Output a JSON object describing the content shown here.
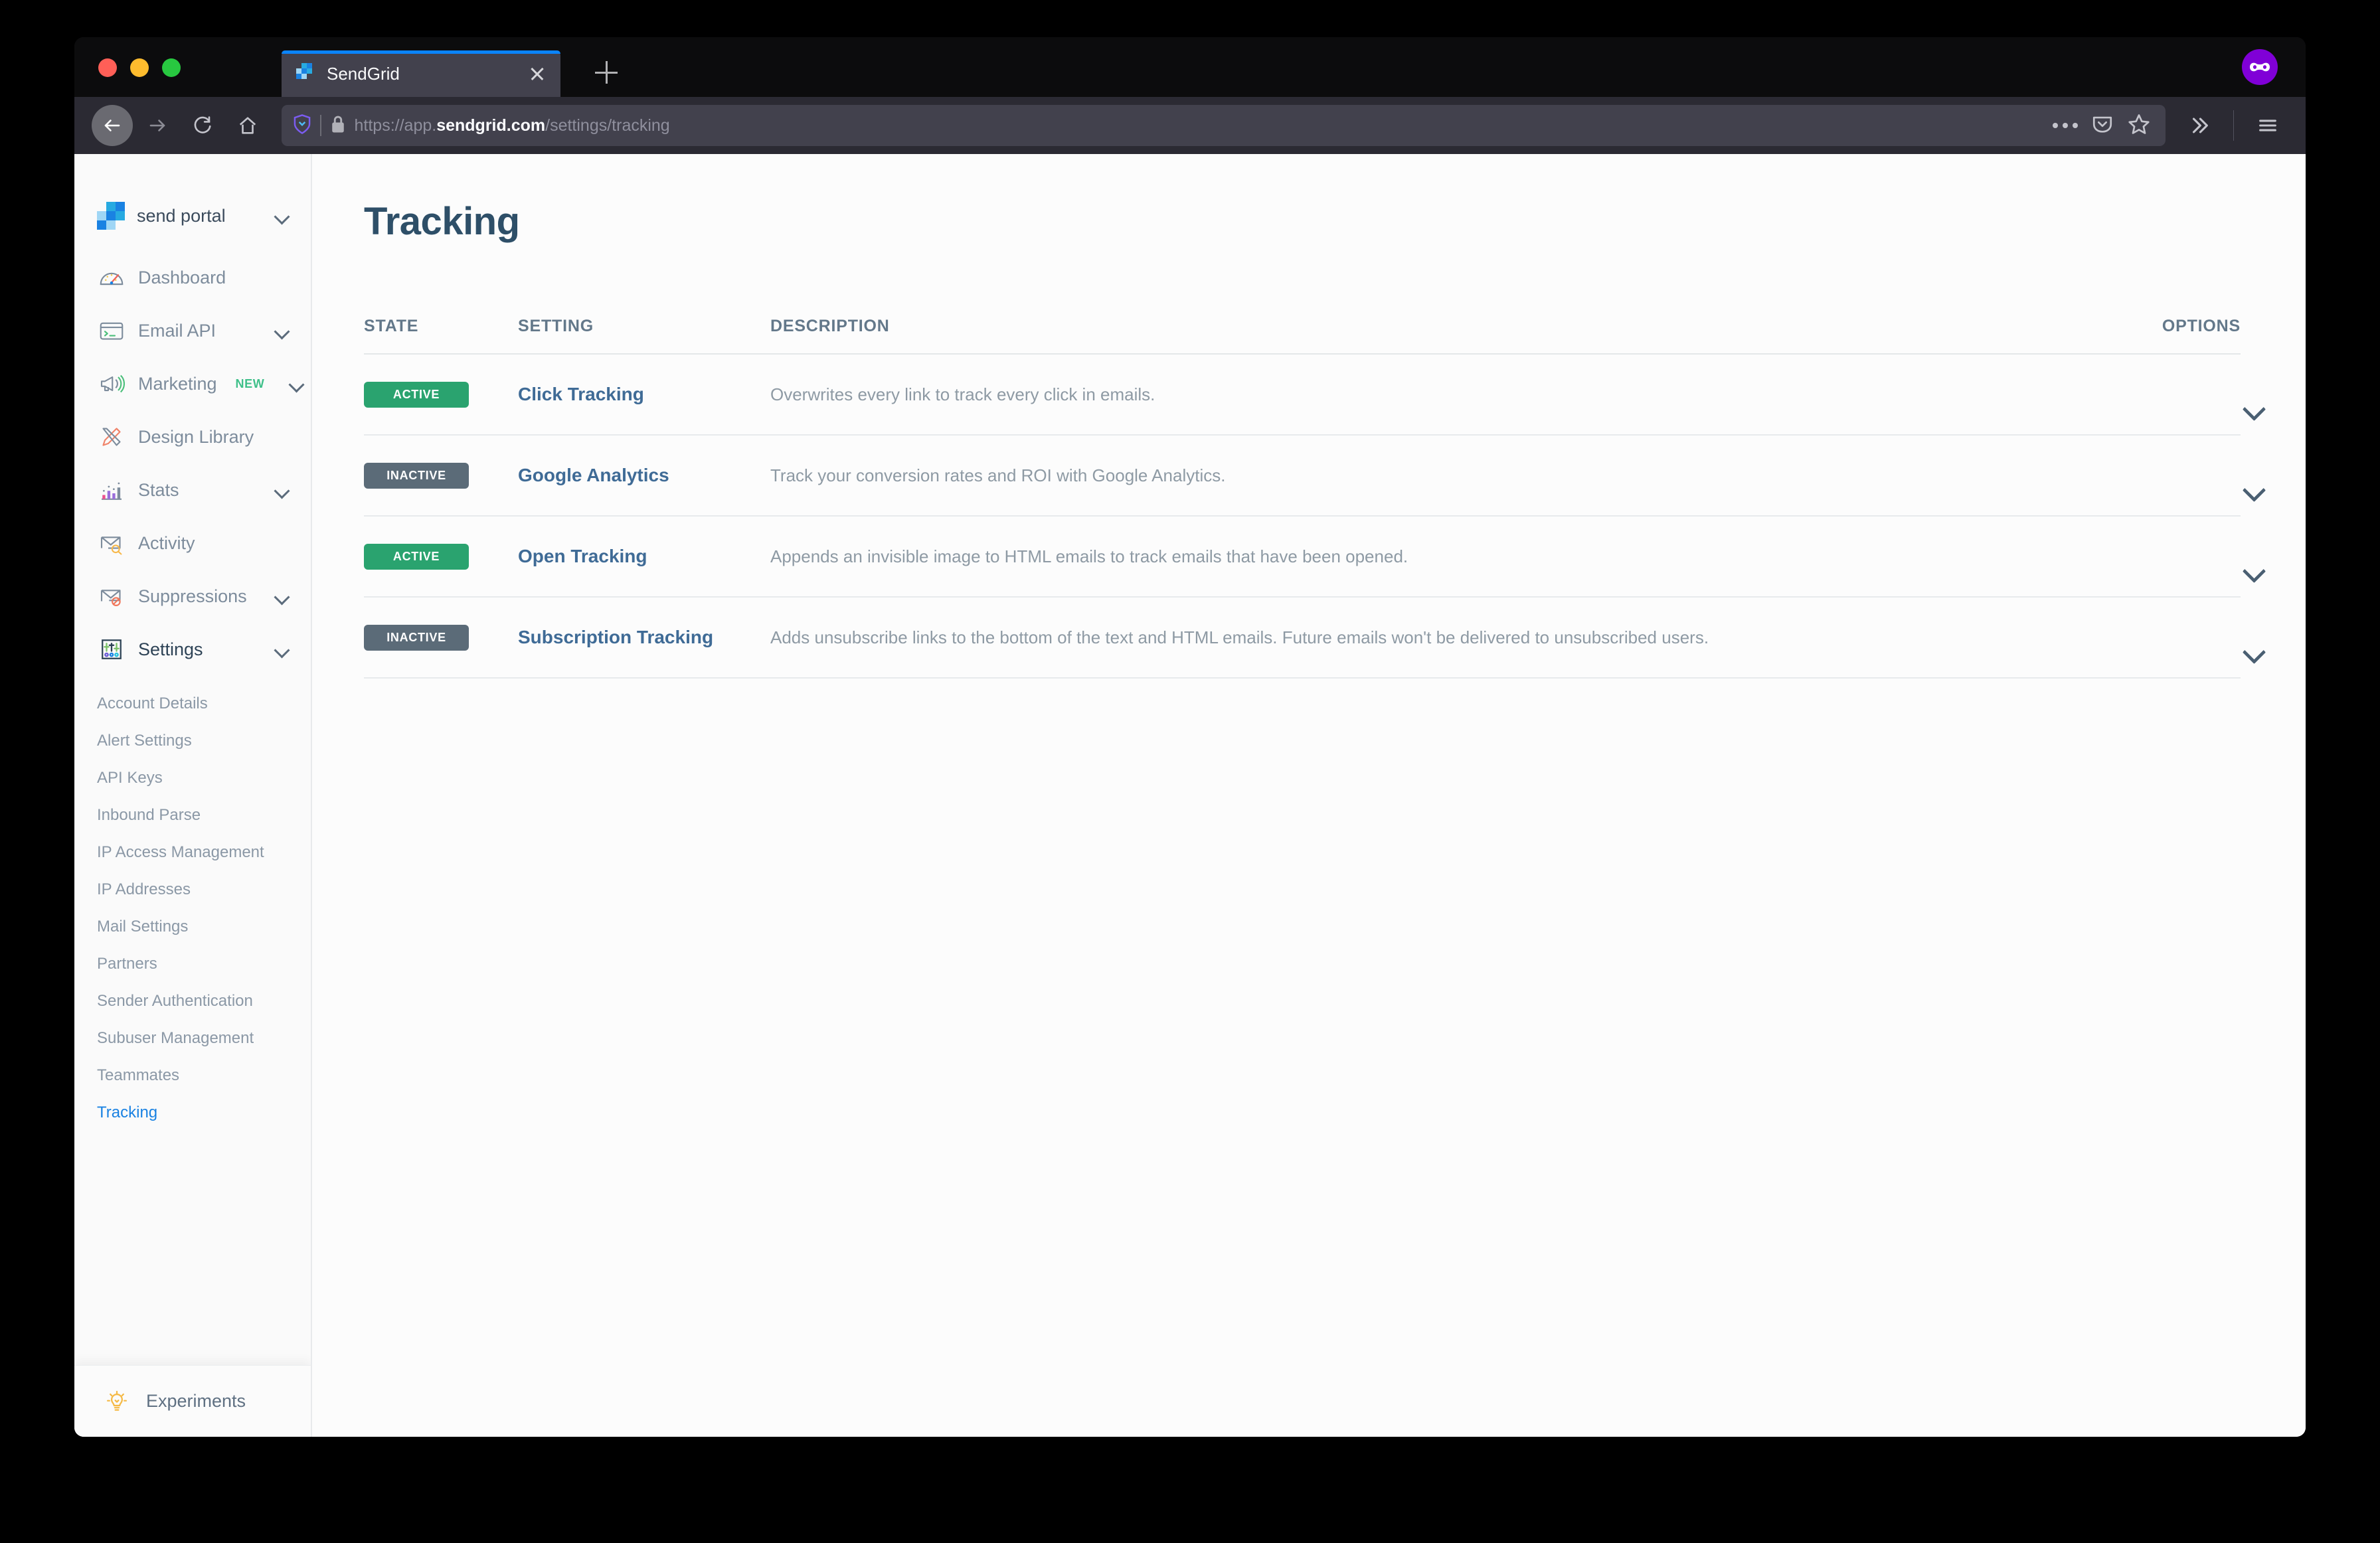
{
  "browser": {
    "tab": {
      "title": "SendGrid",
      "favicon": "sendgrid-logo-icon"
    },
    "new_tab_label": "+",
    "private_mode_icon": "private-mask-icon",
    "url": {
      "prefix": "https://app.",
      "domain": "sendgrid.com",
      "suffix": "/settings/tracking",
      "shield_icon": "tracking-protection-shield-icon",
      "lock_icon": "padlock-icon"
    },
    "toolbar": {
      "back": "back-arrow-icon",
      "forward": "forward-arrow-icon",
      "reload": "reload-icon",
      "home": "home-icon",
      "page_actions": "ellipsis-icon",
      "pocket": "pocket-icon",
      "bookmark": "star-icon",
      "overflow": "double-chevron-right-icon",
      "menu": "hamburger-menu-icon"
    }
  },
  "sidebar": {
    "brand": {
      "name": "send portal",
      "logo": "sendgrid-logo-icon",
      "chevron": "chevron-down-icon"
    },
    "items": [
      {
        "label": "Dashboard",
        "icon": "speedometer-icon",
        "expandable": false,
        "active": false
      },
      {
        "label": "Email API",
        "icon": "terminal-card-icon",
        "expandable": true,
        "active": false
      },
      {
        "label": "Marketing",
        "icon": "megaphone-icon",
        "expandable": true,
        "active": false,
        "badge": "NEW"
      },
      {
        "label": "Design Library",
        "icon": "pencil-ruler-icon",
        "expandable": false,
        "active": false
      },
      {
        "label": "Stats",
        "icon": "bar-chart-icon",
        "expandable": true,
        "active": false
      },
      {
        "label": "Activity",
        "icon": "envelope-search-icon",
        "expandable": false,
        "active": false
      },
      {
        "label": "Suppressions",
        "icon": "envelope-block-icon",
        "expandable": true,
        "active": false
      },
      {
        "label": "Settings",
        "icon": "sliders-icon",
        "expandable": true,
        "active": true
      }
    ],
    "settings_submenu": [
      {
        "label": "Account Details",
        "current": false
      },
      {
        "label": "Alert Settings",
        "current": false
      },
      {
        "label": "API Keys",
        "current": false
      },
      {
        "label": "Inbound Parse",
        "current": false
      },
      {
        "label": "IP Access Management",
        "current": false
      },
      {
        "label": "IP Addresses",
        "current": false
      },
      {
        "label": "Mail Settings",
        "current": false
      },
      {
        "label": "Partners",
        "current": false
      },
      {
        "label": "Sender Authentication",
        "current": false
      },
      {
        "label": "Subuser Management",
        "current": false
      },
      {
        "label": "Teammates",
        "current": false
      },
      {
        "label": "Tracking",
        "current": true
      }
    ],
    "footer": {
      "label": "Experiments",
      "icon": "lightbulb-icon"
    }
  },
  "main": {
    "title": "Tracking",
    "table": {
      "headers": {
        "state": "STATE",
        "setting": "SETTING",
        "description": "DESCRIPTION",
        "options": "OPTIONS"
      },
      "rows": [
        {
          "state": "ACTIVE",
          "state_type": "active",
          "setting": "Click Tracking",
          "description": "Overwrites every link to track every click in emails.",
          "options_icon": "chevron-down-icon"
        },
        {
          "state": "INACTIVE",
          "state_type": "inactive",
          "setting": "Google Analytics",
          "description": "Track your conversion rates and ROI with Google Analytics.",
          "options_icon": "chevron-down-icon"
        },
        {
          "state": "ACTIVE",
          "state_type": "active",
          "setting": "Open Tracking",
          "description": "Appends an invisible image to HTML emails to track emails that have been opened.",
          "options_icon": "chevron-down-icon"
        },
        {
          "state": "INACTIVE",
          "state_type": "inactive",
          "setting": "Subscription Tracking",
          "description": "Adds unsubscribe links to the bottom of the text and HTML emails. Future emails won't be delivered to unsubscribed users.",
          "options_icon": "chevron-down-icon"
        }
      ]
    }
  },
  "colors": {
    "accent_blue": "#1a82e2",
    "active_green": "#2aa36f",
    "inactive_gray": "#5b6b78",
    "title_navy": "#2e4f68",
    "link_blue": "#3f6b96",
    "private_purple": "#8000d7"
  }
}
